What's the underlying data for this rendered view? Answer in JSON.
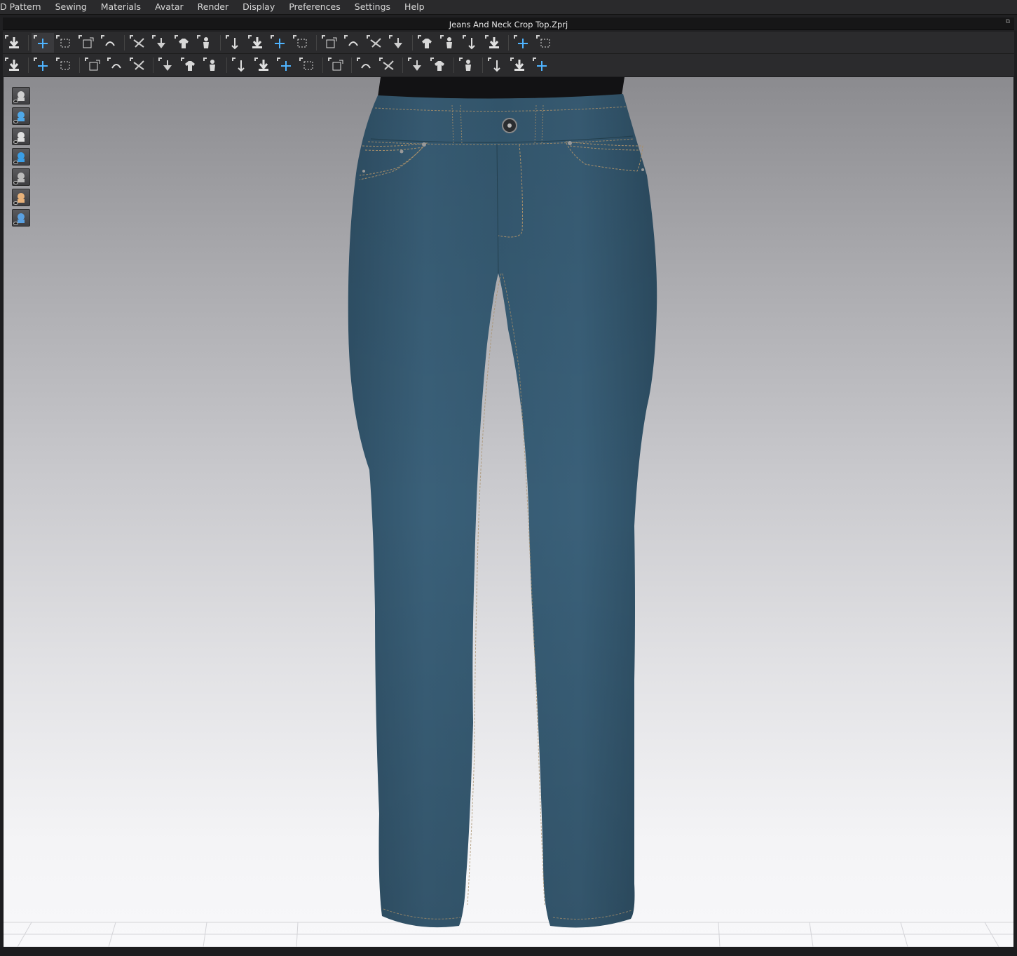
{
  "menu": {
    "items": [
      "D Pattern",
      "Sewing",
      "Materials",
      "Avatar",
      "Render",
      "Display",
      "Preferences",
      "Settings",
      "Help"
    ]
  },
  "window": {
    "title": "Jeans And Neck Crop  Top.Zprj"
  },
  "toolbar_top": {
    "icons": [
      "simulation-icon",
      "select-move-icon",
      "select-box-icon",
      "transform-pattern-icon",
      "edit-curvature-icon",
      "rotate-pattern-icon",
      "flip-pattern-icon",
      "straighten-icon",
      "fold-arrangement-icon",
      "fold-icon",
      "garment-icon",
      "clone-garment-icon",
      "avatar-dress-icon",
      "pin-icon",
      "arrange-up-icon",
      "arrange-down-icon",
      "pressure-icon",
      "layer-icon",
      "stitch-icon",
      "split-icon",
      "measure-icon",
      "tape-icon",
      "ruler-icon"
    ]
  },
  "toolbar_bottom": {
    "icons": [
      "avatar-pose-icon",
      "select-mesh-icon",
      "edit-mesh-icon",
      "fold-line-icon",
      "cut-icon",
      "copy-pattern-icon",
      "sew-icon",
      "check-icon",
      "texture-icon",
      "button-icon",
      "button-hole-icon",
      "line-icon",
      "lock-icon",
      "zipper-icon",
      "puckering-icon",
      "shading-icon",
      "trim-icon",
      "fill-icon",
      "align-icon",
      "shirt-select-icon",
      "shirt-edit-icon",
      "shirt-3d-icon"
    ]
  },
  "viewport": {
    "side_tools": [
      "show-garment-icon",
      "show-pattern-icon",
      "show-avatar-icon",
      "show-fabric-icon",
      "show-texture-icon",
      "show-skin-icon",
      "show-grid-icon"
    ],
    "garment_color": "#355a72",
    "background_top": "#8b8b8f",
    "background_bottom": "#f8f8fa"
  }
}
